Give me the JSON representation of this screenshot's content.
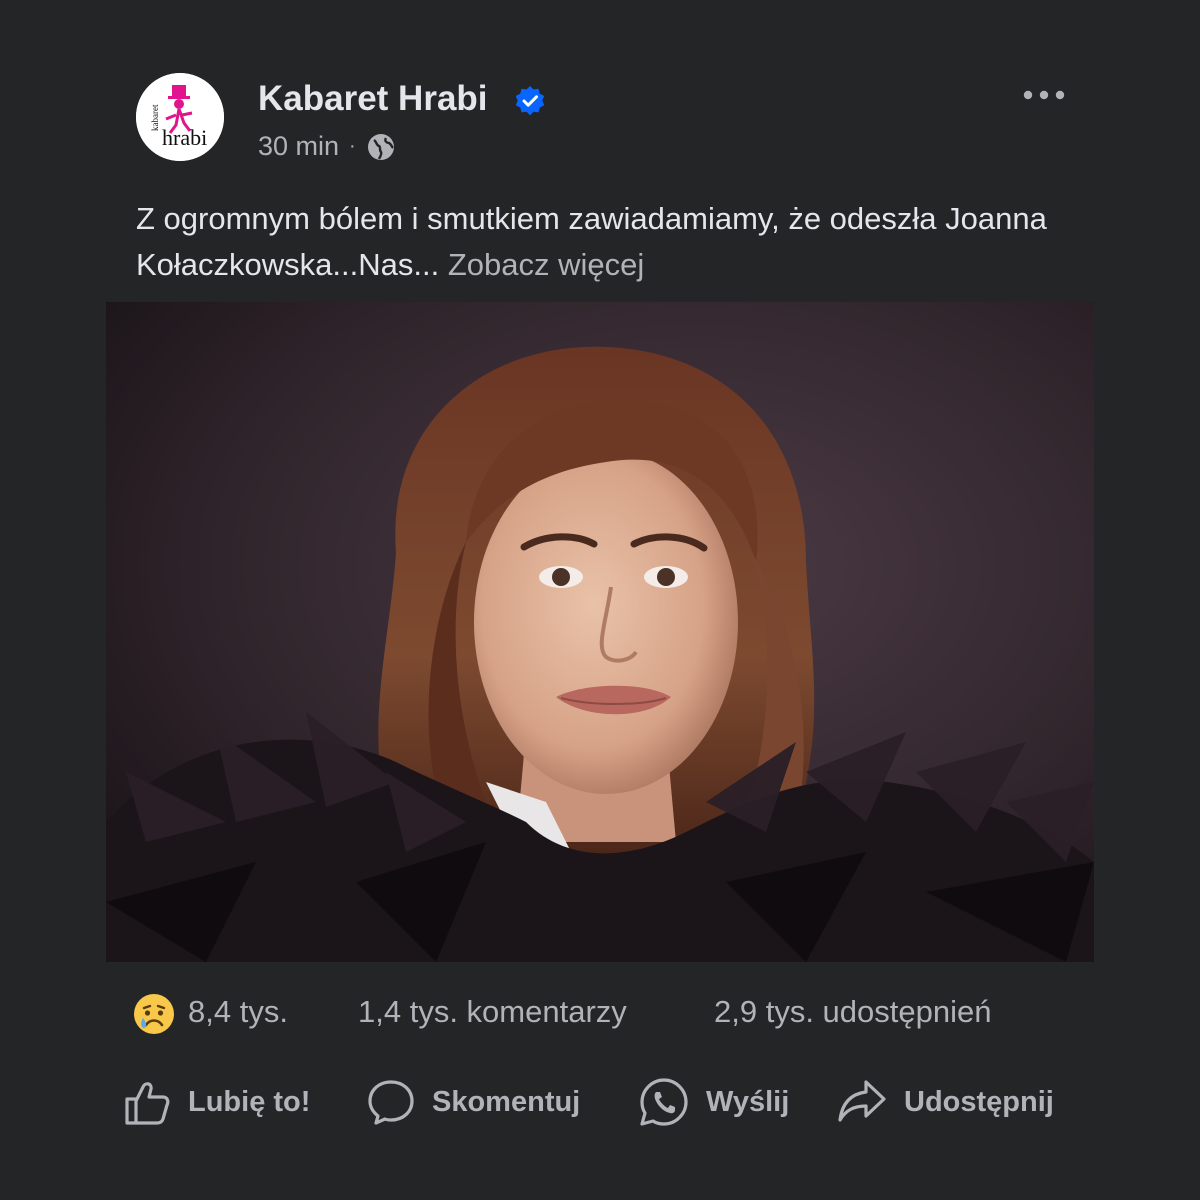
{
  "post": {
    "page_name": "Kabaret Hrabi",
    "logo_text_top": "kabaret",
    "logo_text_main": "hrabi",
    "timestamp": "30 min",
    "meta_separator": "·",
    "audience_icon": "globe-icon",
    "verified_icon": "verified-badge-icon",
    "more_icon": "more-options-icon",
    "text_main": "Z ogromnym bólem i smutkiem zawiadamiamy, że odeszła Joanna Kołaczkowska...Nas... ",
    "see_more": "Zobacz więcej",
    "image_icon": "portrait-photo"
  },
  "stats": {
    "reaction_icon": "sad-face-icon",
    "reactions": "8,4 tys.",
    "comments": "1,4 tys. komentarzy",
    "shares": "2,9 tys. udostępnień"
  },
  "actions": {
    "like": "Lubię to!",
    "comment": "Skomentuj",
    "send": "Wyślij",
    "share": "Udostępnij",
    "like_icon": "thumbs-up-icon",
    "comment_icon": "comment-bubble-icon",
    "send_icon": "whatsapp-icon",
    "share_icon": "share-arrow-icon"
  },
  "colors": {
    "background": "#242526",
    "text_primary": "#e4e6eb",
    "text_secondary": "#b0b3b8",
    "verified": "#0866ff",
    "logo_pink": "#e0148c"
  }
}
